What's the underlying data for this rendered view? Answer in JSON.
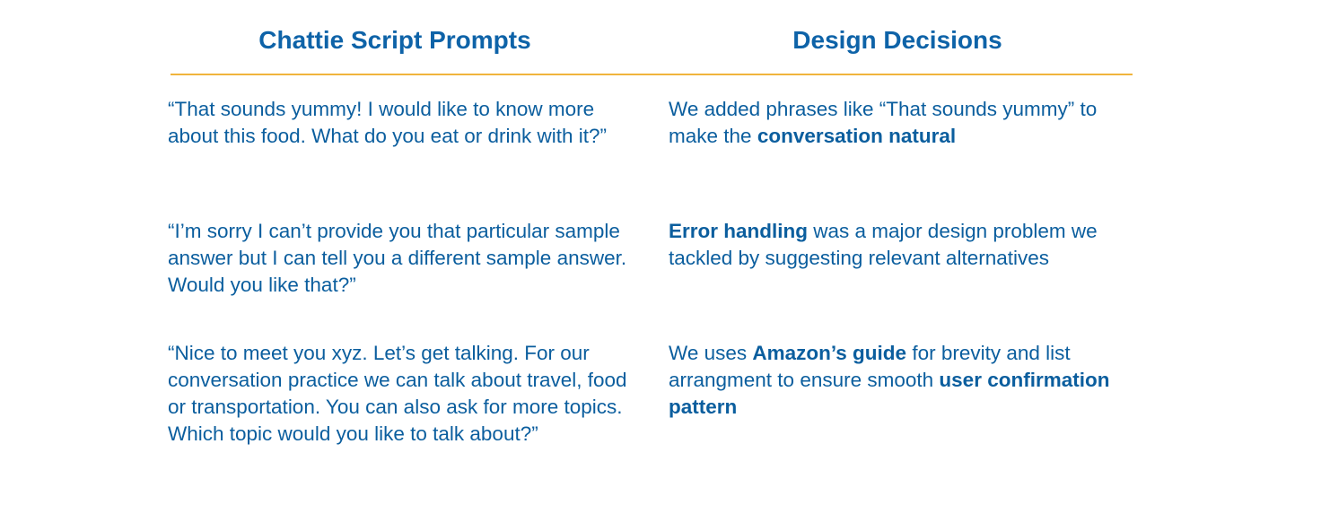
{
  "headers": {
    "left": "Chattie Script Prompts",
    "right": "Design Decisions"
  },
  "colors": {
    "text": "#0b5e9e",
    "divider": "#f0b43c"
  },
  "rows": [
    {
      "prompt": "“That sounds yummy! I would like to know more about this food. What do you eat or drink with it?”",
      "decision": {
        "pre": "We added phrases like “That sounds yummy” to make the ",
        "bold1": "conversation natural",
        "mid": "",
        "bold2": "",
        "post": ""
      }
    },
    {
      "prompt": "“I’m sorry I can’t provide you that particular sample answer but I can tell you a different sample answer. Would you like that?”",
      "decision": {
        "pre": "",
        "bold1": "Error handling",
        "mid": " was a major design problem we tackled by suggesting relevant alternatives",
        "bold2": "",
        "post": ""
      }
    },
    {
      "prompt": "“Nice to meet you xyz. Let’s get talking. For our conversation practice we can talk about travel, food or transportation. You can also ask for more topics. Which topic would you like to talk about?”",
      "decision": {
        "pre": "We uses ",
        "bold1": "Amazon’s guide",
        "mid": " for brevity and list arrangment to ensure smooth ",
        "bold2": "user confirmation pattern",
        "post": ""
      }
    }
  ]
}
